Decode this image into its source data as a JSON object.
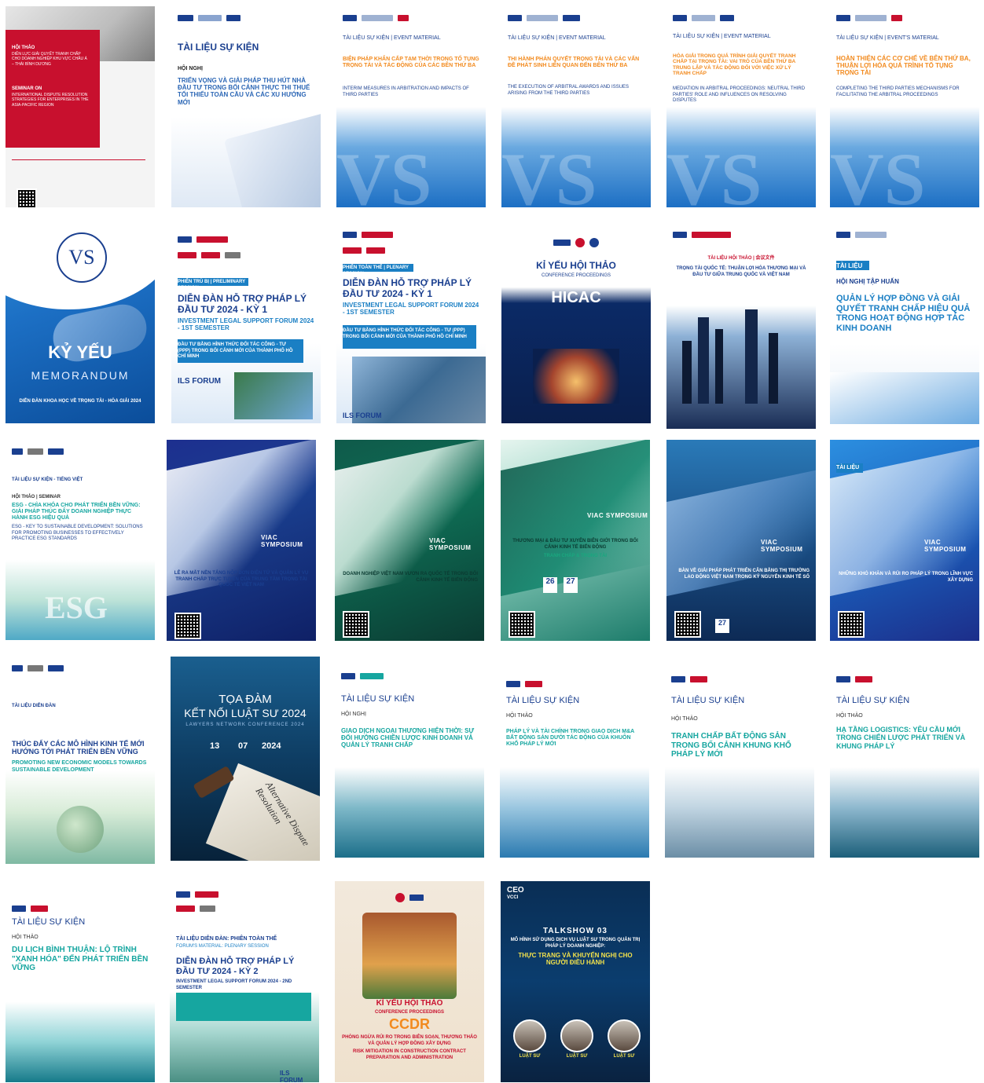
{
  "tiles": [
    {
      "id": "t1",
      "lines": [
        "HỘI THẢO",
        "DIỄN LỰC GIẢI QUYẾT TRANH CHẤP CHO DOANH NGHIỆP KHU VỰC CHÂU Á – THÁI BÌNH DƯƠNG",
        "SEMINAR ON",
        "INTERNATIONAL DISPUTE RESOLUTION STRATEGIES FOR ENTERPRISES IN THE ASIA-PACIFIC REGION"
      ]
    },
    {
      "id": "t2",
      "lines": [
        "TÀI LIỆU SỰ KIỆN",
        "HỘI NGHỊ",
        "TRIỂN VỌNG VÀ GIẢI PHÁP THU HÚT NHÀ ĐẦU TƯ TRONG BỐI CẢNH THỰC THI THUẾ TỐI THIỂU TOÀN CẦU VÀ CÁC XU HƯỚNG MỚI"
      ]
    },
    {
      "id": "t3",
      "lines": [
        "TÀI LIỆU SỰ KIỆN | EVENT MATERIAL",
        "BIỆN PHÁP KHẨN CẤP TẠM THỜI TRONG TỐ TỤNG TRỌNG TÀI VÀ TÁC ĐỘNG CỦA CÁC BÊN THỨ BA",
        "INTERIM MEASURES IN ARBITRATION AND IMPACTS OF THIRD PARTIES"
      ]
    },
    {
      "id": "t4",
      "lines": [
        "TÀI LIỆU SỰ KIỆN | EVENT MATERIAL",
        "THI HÀNH PHÁN QUYẾT TRỌNG TÀI VÀ CÁC VẤN ĐỀ PHÁT SINH LIÊN QUAN ĐẾN BÊN THỨ BA",
        "THE EXECUTION OF ARBITRAL AWARDS AND ISSUES ARISING FROM THE THIRD PARTIES"
      ]
    },
    {
      "id": "t5",
      "lines": [
        "TÀI LIỆU SỰ KIỆN | EVENT MATERIAL",
        "HÒA GIẢI TRONG QUÁ TRÌNH GIẢI QUYẾT TRANH CHẤP TẠI TRỌNG TÀI: VAI TRÒ CỦA BÊN THỨ BA TRUNG LẬP VÀ TÁC ĐỘNG ĐỐI VỚI VIỆC XỬ LÝ TRANH CHẤP",
        "MEDIATION IN ARBITRAL PROCEEDINGS: NEUTRAL THIRD PARTIES' ROLE AND INFLUENCES ON RESOLVING DISPUTES"
      ]
    },
    {
      "id": "t6",
      "lines": [
        "TÀI LIỆU SỰ KIỆN | EVENT'S MATERIAL",
        "HOÀN THIỆN CÁC CƠ CHẾ VỀ BÊN THỨ BA, THUẬN LỢI HÓA QUÁ TRÌNH TỐ TỤNG TRỌNG TÀI",
        "COMPLETING THE THIRD PARTIES MECHANISMS FOR FACILITATING THE ARBITRAL PROCEEDINGS"
      ]
    },
    {
      "id": "t7",
      "lines": [
        "KỶ YẾU",
        "MEMORANDUM",
        "DIỄN ĐÀN KHOA HỌC VỀ TRỌNG TÀI - HÒA GIẢI 2024"
      ]
    },
    {
      "id": "t8",
      "lines": [
        "PHIÊN TRÙ BỊ | PRELIMINARY SESSION",
        "DIỄN ĐÀN HỖ TRỢ PHÁP LÝ ĐẦU TƯ 2024 - KỲ 1",
        "INVESTMENT LEGAL SUPPORT FORUM 2024 - 1ST SEMESTER",
        "ĐẦU TƯ BẰNG HÌNH THỨC ĐỐI TÁC CÔNG - TƯ (PPP) TRONG BỐI CẢNH MỚI CỦA THÀNH PHỐ HỒ CHÍ MINH",
        "ILS FORUM"
      ]
    },
    {
      "id": "t9",
      "lines": [
        "PHIÊN TOÀN THỂ | PLENARY SESSION",
        "DIỄN ĐÀN HỖ TRỢ PHÁP LÝ ĐẦU TƯ 2024 - KỲ 1",
        "INVESTMENT LEGAL SUPPORT FORUM 2024 - 1ST SEMESTER",
        "ĐẦU TƯ BẰNG HÌNH THỨC ĐỐI TÁC CÔNG - TƯ (PPP) TRONG BỐI CẢNH MỚI CỦA THÀNH PHỐ HỒ CHÍ MINH",
        "ILS FORUM"
      ]
    },
    {
      "id": "t10",
      "lines": [
        "KỈ YẾU HỘI THẢO",
        "CONFERENCE PROCEEDINGS",
        "HICAC"
      ]
    },
    {
      "id": "t11",
      "lines": [
        "TÀI LIỆU HỘI THẢO | 会议文件",
        "TRỌNG TÀI QUỐC TẾ: THUẬN LỢI HÓA THƯƠNG MẠI VÀ ĐẦU TƯ GIỮA TRUNG QUỐC VÀ VIỆT NAM"
      ]
    },
    {
      "id": "t12",
      "lines": [
        "TÀI LIỆU",
        "HỘI NGHỊ TẬP HUẤN",
        "QUẢN LÝ HỢP ĐỒNG VÀ GIẢI QUYẾT TRANH CHẤP HIỆU QUẢ TRONG HOẠT ĐỘNG HỢP TÁC KINH DOANH"
      ]
    },
    {
      "id": "t13",
      "lines": [
        "TÀI LIỆU SỰ KIỆN - TIẾNG VIỆT",
        "HỘI THẢO | SEMINAR",
        "ESG - CHÌA KHÓA CHO PHÁT TRIỂN BỀN VỮNG: GIẢI PHÁP THÚC ĐẨY DOANH NGHIỆP THỰC HÀNH ESG HIỆU QUẢ",
        "ESG - KEY TO SUSTAINABLE DEVELOPMENT: SOLUTIONS FOR PROMOTING BUSINESSES TO EFFECTIVELY PRACTICE ESG STANDARDS"
      ]
    },
    {
      "id": "t14",
      "lines": [
        "VIAC SYMPOSIUM",
        "LÊ RA MẮT NỀN TẢNG NỘP ĐƠN ĐIỆN TỬ VÀ QUẢN LÝ VỤ TRANH CHẤP TRỰC TUYẾN CỦA TRUNG TÂM TRỌNG TÀI QUỐC TẾ VIỆT NAM"
      ]
    },
    {
      "id": "t15",
      "lines": [
        "VIAC SYMPOSIUM",
        "DOANH NGHIỆP VIỆT NAM VƯƠN RA QUỐC TẾ TRONG BỐI CẢNH KINH TẾ BIẾN ĐỘNG"
      ]
    },
    {
      "id": "t16",
      "lines": [
        "VIAC SYMPOSIUM",
        "THƯƠNG MẠI & ĐẦU TƯ XUYÊN BIÊN GIỚI TRONG BỐI CẢNH KINH TẾ BIẾN ĐỘNG",
        "TRANH CHẤP & TRỌNG TÀI",
        "26",
        "27"
      ]
    },
    {
      "id": "t17",
      "lines": [
        "VIAC SYMPOSIUM",
        "BÀN VỀ GIẢI PHÁP PHÁT TRIỂN CÂN BẰNG THỊ TRƯỜNG LAO ĐỘNG VIỆT NAM TRONG KỶ NGUYÊN KINH TẾ SỐ",
        "27"
      ]
    },
    {
      "id": "t18",
      "lines": [
        "TÀI LIỆU",
        "VIAC SYMPOSIUM",
        "NHỮNG KHÓ KHĂN VÀ RỦI RO PHÁP LÝ TRONG LĨNH VỰC XÂY DỰNG"
      ]
    },
    {
      "id": "t19",
      "lines": [
        "TÀI LIỆU DIỄN ĐÀN",
        "THÚC ĐẨY CÁC MÔ HÌNH KINH TẾ MỚI HƯỚNG TỚI PHÁT TRIỂN BỀN VỮNG",
        "PROMOTING NEW ECONOMIC MODELS TOWARDS SUSTAINABLE DEVELOPMENT"
      ]
    },
    {
      "id": "t20",
      "lines": [
        "TỌA ĐÀM",
        "KẾT NỐI LUẬT SƯ 2024",
        "LAWYERS NETWORK CONFERENCE 2024",
        "13",
        "07",
        "2024",
        "Alternative Dispute Resolution"
      ]
    },
    {
      "id": "t21",
      "lines": [
        "TÀI LIỆU SỰ KIỆN",
        "HỘI NGHỊ",
        "GIAO DỊCH NGOẠI THƯƠNG HIỆN THỜI: SỰ ĐỔI HƯỚNG CHIẾN LƯỢC KINH DOANH VÀ QUẢN LÝ TRANH CHẤP"
      ]
    },
    {
      "id": "t22",
      "lines": [
        "TÀI LIỆU SỰ KIỆN",
        "HỘI THẢO",
        "PHÁP LÝ VÀ TÀI CHÍNH TRONG GIAO DỊCH M&A BẤT ĐỘNG SẢN DƯỚI TÁC ĐỘNG CỦA KHUÔN KHỔ PHÁP LÝ MỚI"
      ]
    },
    {
      "id": "t23",
      "lines": [
        "TÀI LIỆU SỰ KIỆN",
        "HỘI THẢO",
        "TRANH CHẤP BẤT ĐỘNG SẢN TRONG BỐI CẢNH KHUNG KHỔ PHÁP LÝ MỚI"
      ]
    },
    {
      "id": "t24",
      "lines": [
        "TÀI LIỆU SỰ KIỆN",
        "HỘI THẢO",
        "HẠ TẦNG LOGISTICS: YÊU CẦU MỚI TRONG CHIẾN LƯỢC PHÁT TRIỂN VÀ KHUNG PHÁP LÝ"
      ]
    },
    {
      "id": "t25",
      "lines": [
        "TÀI LIỆU SỰ KIỆN",
        "HỘI THẢO",
        "DU LỊCH BÌNH THUẬN: LỘ TRÌNH \"XANH HÓA\" ĐẾN PHÁT TRIỂN BỀN VỮNG"
      ]
    },
    {
      "id": "t26",
      "lines": [
        "TÀI LIỆU DIỄN ĐÀN: PHIÊN TOÀN THỂ",
        "FORUM'S MATERIAL: PLENARY SESSION",
        "DIỄN ĐÀN HỖ TRỢ PHÁP LÝ ĐẦU TƯ 2024 - KỲ 2",
        "INVESTMENT LEGAL SUPPORT FORUM 2024 - 2ND SEMESTER",
        "ILS FORUM"
      ]
    },
    {
      "id": "t27",
      "lines": [
        "KỈ YẾU HỘI THẢO",
        "CONFERENCE PROCEEDINGS",
        "CCDR",
        "PHÒNG NGỪA RỦI RO TRONG BIÊN SOẠN, THƯƠNG THẢO VÀ QUẢN LÝ HỢP ĐỒNG XÂY DỰNG",
        "RISK MITIGATION IN CONSTRUCTION CONTRACT PREPARATION AND ADMINISTRATION"
      ]
    },
    {
      "id": "t28",
      "lines": [
        "CEO",
        "VCCI",
        "TALKSHOW 03",
        "MÔ HÌNH SỬ DỤNG DỊCH VỤ LUẬT SƯ TRONG QUẢN TRỊ PHÁP LÝ DOANH NGHIỆP:",
        "THỰC TRẠNG VÀ KHUYẾN NGHỊ CHO NGƯỜI ĐIỀU HÀNH",
        "LUẬT SƯ",
        "LUẬT SƯ",
        "LUẬT SƯ"
      ]
    }
  ],
  "colors": {
    "viac_blue": "#1a3f8f",
    "accent_orange": "#f28a1e",
    "teal": "#16a6a0",
    "red": "#c8102e"
  }
}
